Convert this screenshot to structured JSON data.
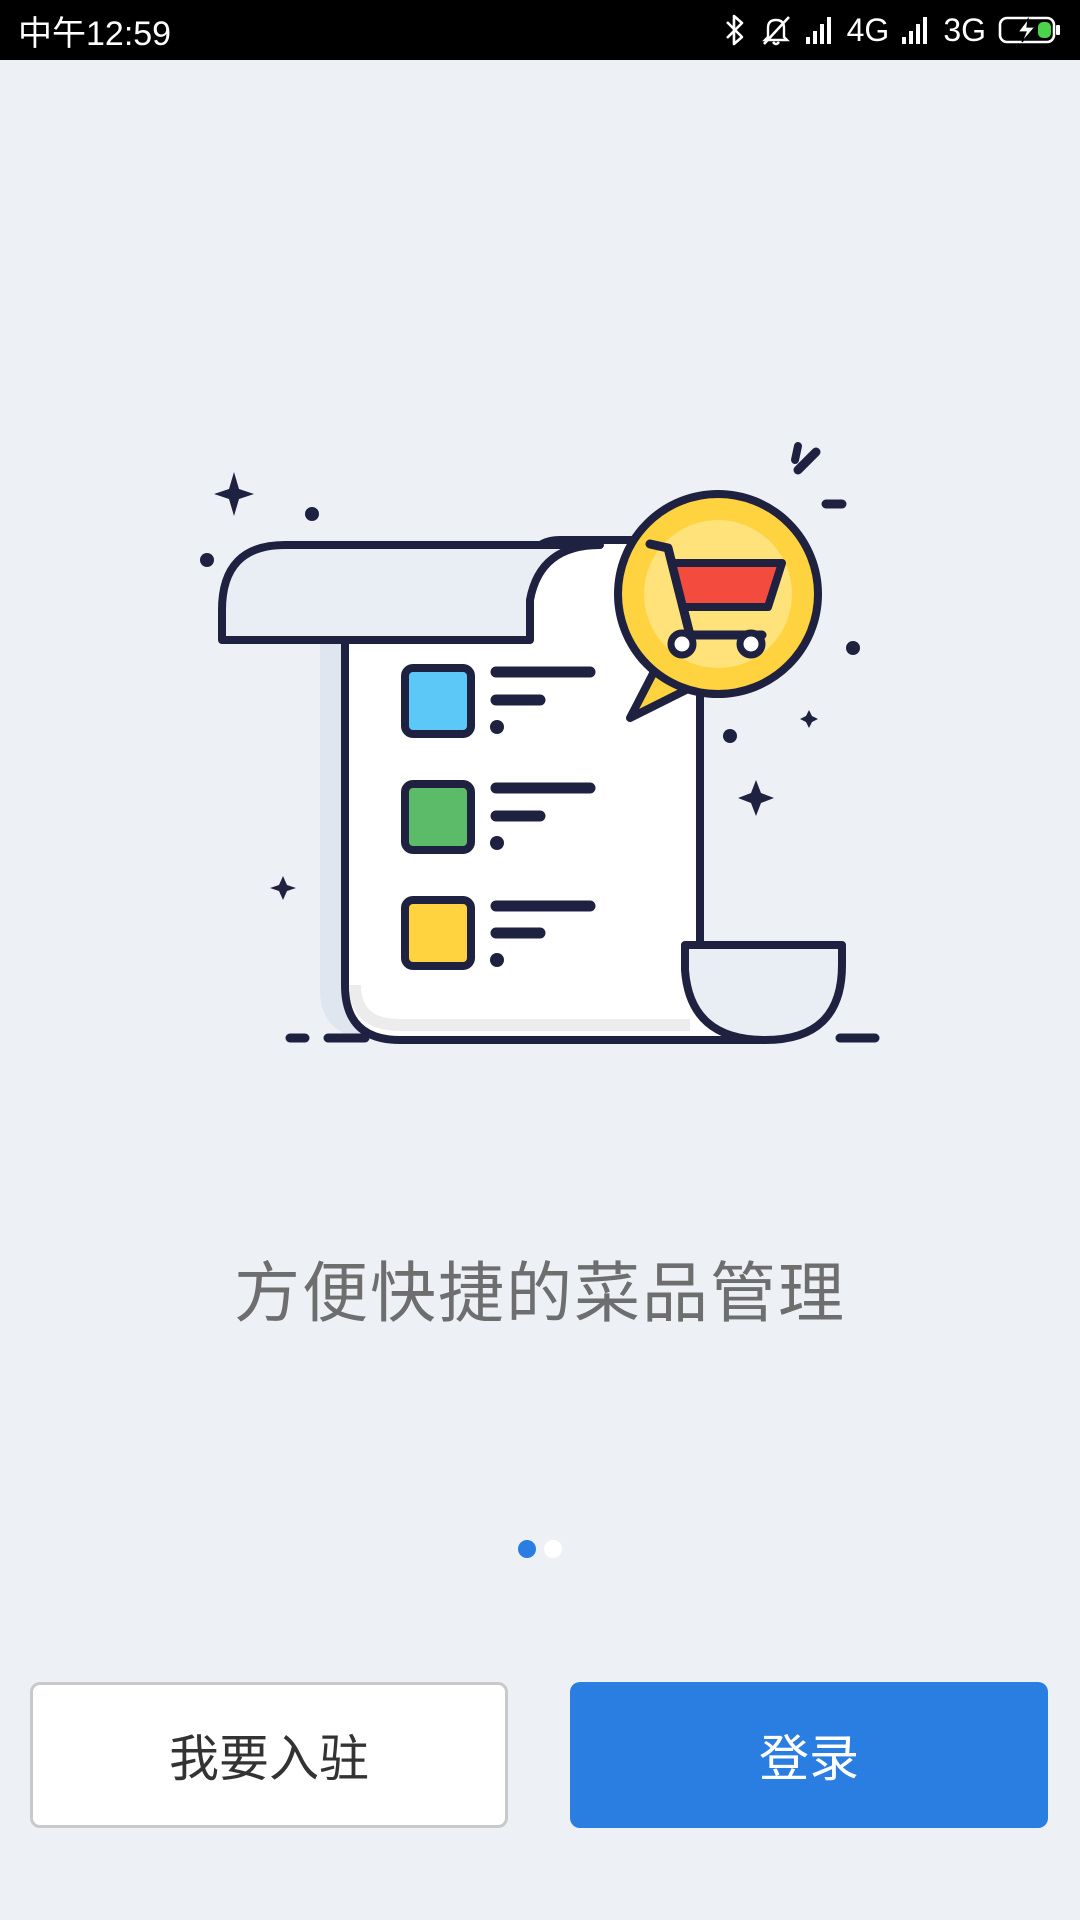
{
  "status_bar": {
    "time": "中午12:59",
    "network1": "4G",
    "network2": "3G",
    "icons": [
      "bluetooth-icon",
      "bell-off-icon",
      "signal-icon",
      "signal-icon",
      "battery-charging-icon"
    ]
  },
  "onboarding": {
    "slogan": "方便快捷的菜品管理",
    "page_count": 2,
    "active_page": 1
  },
  "actions": {
    "register_label": "我要入驻",
    "login_label": "登录"
  },
  "colors": {
    "background": "#edf1f6",
    "primary": "#2a7de1",
    "outline": "#1f2140",
    "cart_badge": "#ffd23f",
    "cart_basket": "#f44b3f",
    "item_blue": "#5cc8f7",
    "item_green": "#5cbb68",
    "item_yellow": "#ffd23f"
  }
}
